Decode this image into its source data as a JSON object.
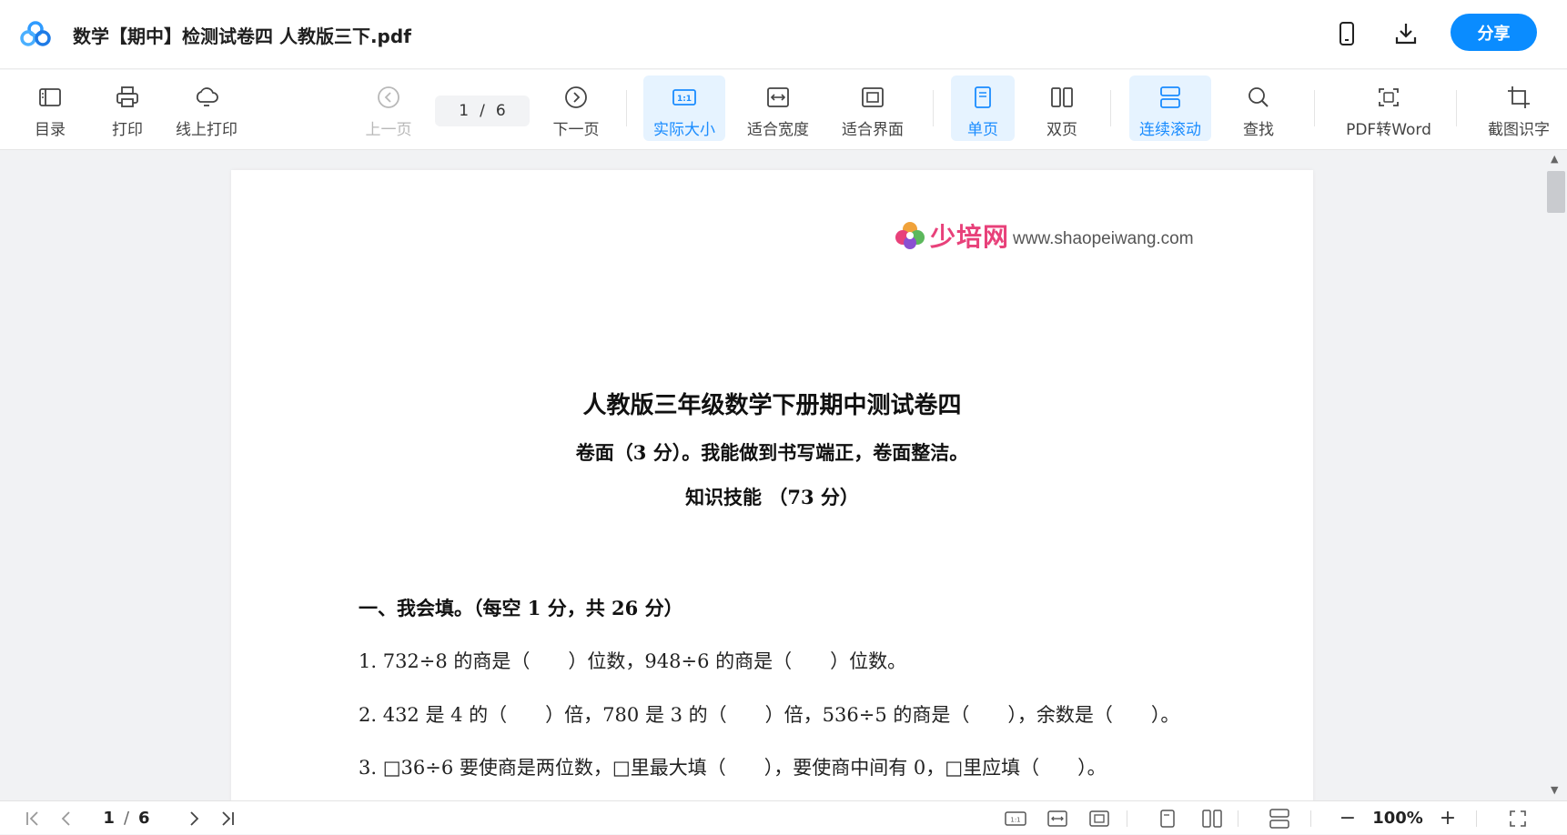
{
  "window": {
    "doc_title": "数学【期中】检测试卷四 人教版三下.pdf",
    "share_label": "分享"
  },
  "toolbar": {
    "toc": "目录",
    "print": "打印",
    "online_print": "线上打印",
    "prev_page": "上一页",
    "page_current": "1",
    "page_sep": "/",
    "page_total": "6",
    "next_page": "下一页",
    "actual_size": "实际大小",
    "fit_width": "适合宽度",
    "fit_screen": "适合界面",
    "single_page": "单页",
    "double_page": "双页",
    "continuous_scroll": "连续滚动",
    "find": "查找",
    "pdf_to_word": "PDF转Word",
    "screenshot_ocr": "截图识字"
  },
  "document": {
    "brand_name": "少培网",
    "brand_url": "www.shaopeiwang.com",
    "title": "人教版三年级数学下册期中测试卷四",
    "subtitle": "卷面（3 分）。我能做到书写端正，卷面整洁。",
    "section_heading": "知识技能 （73 分）",
    "part_title": "一、我会填。（每空 1 分，共 26 分）",
    "questions": [
      "1. 732÷8 的商是（　　）位数，948÷6 的商是（　　）位数。",
      "2. 432 是 4 的（　　）倍，780 是 3 的（　　）倍，536÷5 的商是（　　），余数是（　　）。",
      "3. □36÷6 要使商是两位数，□里最大填（　　），要使商中间有 0，□里应填（　　）。"
    ]
  },
  "statusbar": {
    "page_current": "1",
    "page_sep": "/",
    "page_total": "6",
    "zoom": "100%"
  },
  "colors": {
    "accent": "#0a8cff",
    "active_bg": "#e6f3ff"
  }
}
